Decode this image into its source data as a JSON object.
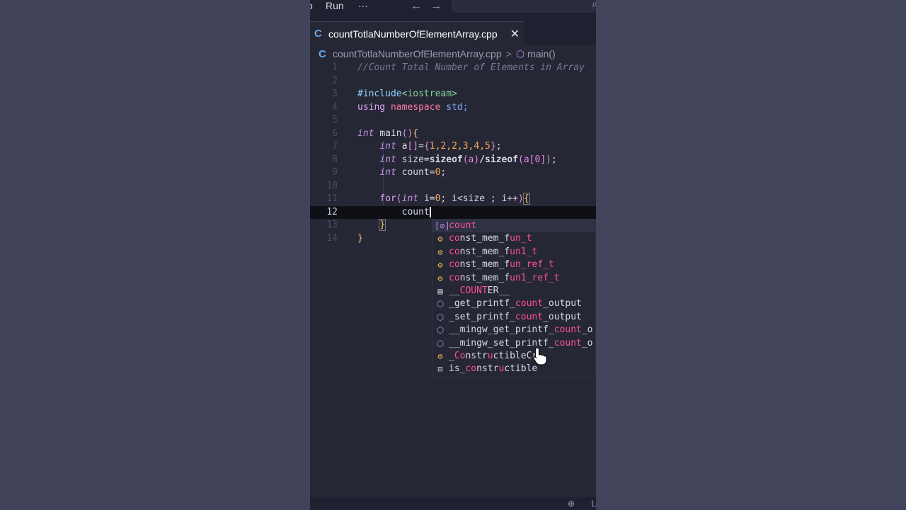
{
  "menu": {
    "prev_item": "o",
    "run_label": "Run",
    "more_label": "···",
    "back_arrow": "←",
    "forward_arrow": "→",
    "search_icon_glyph": "⌕"
  },
  "tab": {
    "icon_glyph": "C",
    "title": "countTotlaNumberOfElementArray.cpp",
    "close_glyph": "✕"
  },
  "breadcrumb": {
    "file": "countTotlaNumberOfElementArray.cpp",
    "separator": ">",
    "symbol_icon": "⬡",
    "symbol": "main()"
  },
  "code": {
    "line_numbers": [
      "1",
      "2",
      "3",
      "4",
      "5",
      "6",
      "7",
      "8",
      "9",
      "10",
      "11",
      "12",
      "13",
      "14"
    ],
    "l1_comment": "//Count Total Number of Elements in Array",
    "l3_include": "#include",
    "l3_header": "<iostream>",
    "l4_using": "using",
    "l4_namespace": "namespace",
    "l4_std": "std;",
    "l6_int": "int",
    "l6_main": "main",
    "l6_parens": "()",
    "l6_brace": "{",
    "l7_int": "int",
    "l7_rest_a": "a",
    "l7_brk": "[]",
    "l7_eq": "=",
    "l7_open": "{",
    "l7_nums": "1,2,2,3,4,5",
    "l7_close": "}",
    "l7_semi": ";",
    "l8_int": "int",
    "l8_size": "size=",
    "l8_sizeof1": "sizeof",
    "l8_arg1": "(a)",
    "l8_div": "/",
    "l8_sizeof2": "sizeof",
    "l8_arg2": "(a[0])",
    "l8_semi": ";",
    "l9_int": "int",
    "l9_count": "count=",
    "l9_zero": "0",
    "l9_semi": ";",
    "l11_for": "for",
    "l11_open": "(",
    "l11_int": "int",
    "l11_i": "i=",
    "l11_zero": "0",
    "l11_rest": "; i<size ; i++",
    "l11_close": ")",
    "l11_brace": "{",
    "l12_typed": "count",
    "l13_brace": "}",
    "l14_brace": "}"
  },
  "suggestions": [
    {
      "icon": "variable-icon",
      "glyph": "[⊘]",
      "pre": "",
      "match": "count",
      "post": "",
      "selected": true
    },
    {
      "icon": "class-icon",
      "glyph": "⚙",
      "pre": "",
      "match": "co",
      "post": "nst_mem_f",
      "m2": "u",
      "post2": "n_t"
    },
    {
      "icon": "class-icon",
      "glyph": "⚙",
      "pre": "",
      "match": "co",
      "post": "nst_mem_f",
      "m2": "u",
      "post2": "n1_t"
    },
    {
      "icon": "class-icon",
      "glyph": "⚙",
      "pre": "",
      "match": "co",
      "post": "nst_mem_f",
      "m2": "u",
      "post2": "n_ref_t"
    },
    {
      "icon": "class-icon",
      "glyph": "⚙",
      "pre": "",
      "match": "co",
      "post": "nst_mem_f",
      "m2": "u",
      "post2": "n1_ref_t"
    },
    {
      "icon": "text-icon",
      "glyph": "▤",
      "pre": "__",
      "match": "COUNT",
      "post": "ER__"
    },
    {
      "icon": "method-icon",
      "glyph": "⬡",
      "pre": "_get_printf_",
      "match": "count",
      "post": "_output"
    },
    {
      "icon": "method-icon",
      "glyph": "⬡",
      "pre": "_set_printf_",
      "match": "count",
      "post": "_output"
    },
    {
      "icon": "method-icon",
      "glyph": "⬡",
      "pre": "__mingw_get_printf_",
      "match": "count",
      "post": "_o"
    },
    {
      "icon": "method-icon",
      "glyph": "⬡",
      "pre": "__mingw_set_printf_",
      "match": "count",
      "post": "_o"
    },
    {
      "icon": "class-icon",
      "glyph": "⚙",
      "pre": "_",
      "match": "Co",
      "post": "nstr",
      "m2": "u",
      "post2": "ctibleC",
      "m3": "",
      "post3": "r"
    },
    {
      "icon": "struct-icon",
      "glyph": "⊟",
      "pre": "is_",
      "match": "co",
      "post": "nstr",
      "m2": "u",
      "post2": "ct",
      "m3": "",
      "post3": "ible"
    }
  ],
  "status": {
    "zoom_glyph": "⊕",
    "right_text": "L"
  }
}
